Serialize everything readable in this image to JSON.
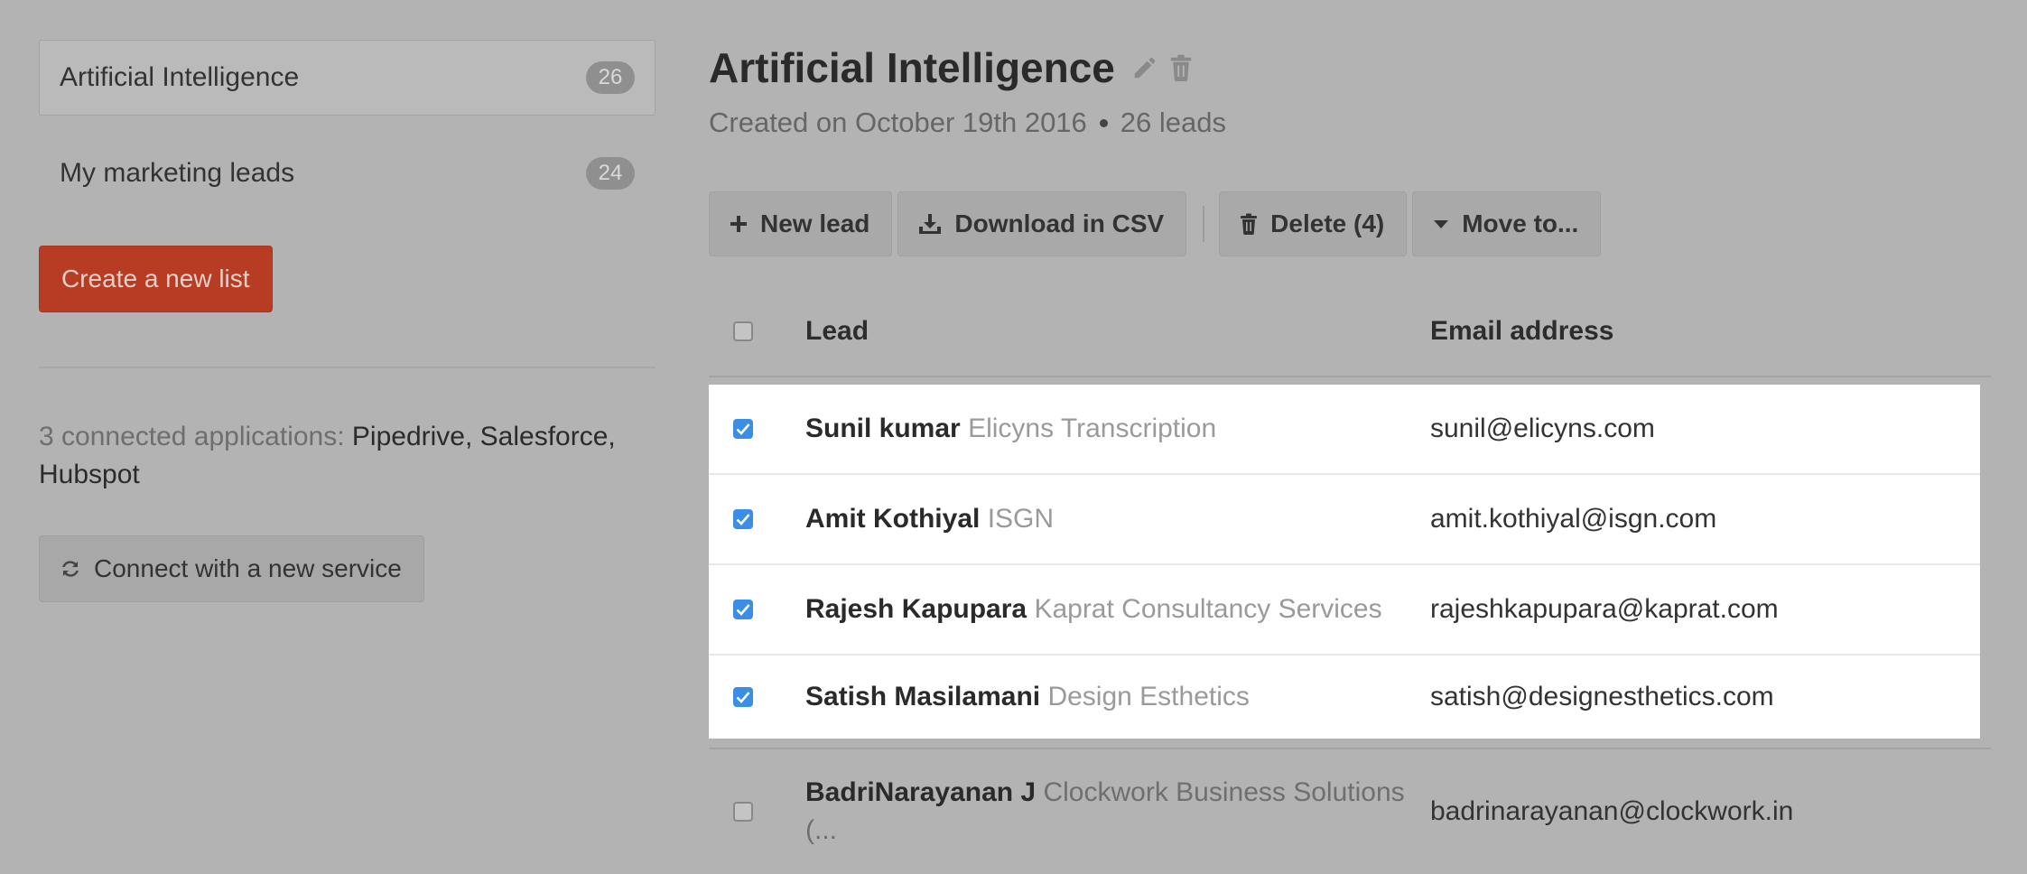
{
  "sidebar": {
    "lists": [
      {
        "label": "Artificial Intelligence",
        "count": "26",
        "active": true
      },
      {
        "label": "My marketing leads",
        "count": "24",
        "active": false
      }
    ],
    "create_button": "Create a new list",
    "connected_prefix": "3 connected applications: ",
    "connected_apps": "Pipedrive, Salesforce, Hubspot",
    "connect_button": "Connect with a new service"
  },
  "header": {
    "title": "Artificial Intelligence",
    "created": "Created on October 19th 2016",
    "leads_count": "26 leads"
  },
  "toolbar": {
    "new_lead": "New lead",
    "download_csv": "Download in CSV",
    "delete": "Delete (4)",
    "move_to": "Move to..."
  },
  "table": {
    "headers": {
      "lead": "Lead",
      "email": "Email address"
    },
    "rows": [
      {
        "name": "Sunil kumar",
        "company": "Elicyns Transcription",
        "email": "sunil@elicyns.com",
        "checked": true
      },
      {
        "name": "Amit Kothiyal",
        "company": "ISGN",
        "email": "amit.kothiyal@isgn.com",
        "checked": true
      },
      {
        "name": "Rajesh Kapupara",
        "company": "Kaprat Consultancy Services",
        "email": "rajeshkapupara@kaprat.com",
        "checked": true
      },
      {
        "name": "Satish Masilamani",
        "company": "Design Esthetics",
        "email": "satish@designesthetics.com",
        "checked": true
      },
      {
        "name": "BadriNarayanan J",
        "company": "Clockwork Business Solutions (...",
        "email": "badrinarayanan@clockwork.in",
        "checked": false
      }
    ]
  },
  "colors": {
    "accent": "#b83c23",
    "checkbox": "#3a8ee6",
    "overlay": "#b3b3b3"
  }
}
